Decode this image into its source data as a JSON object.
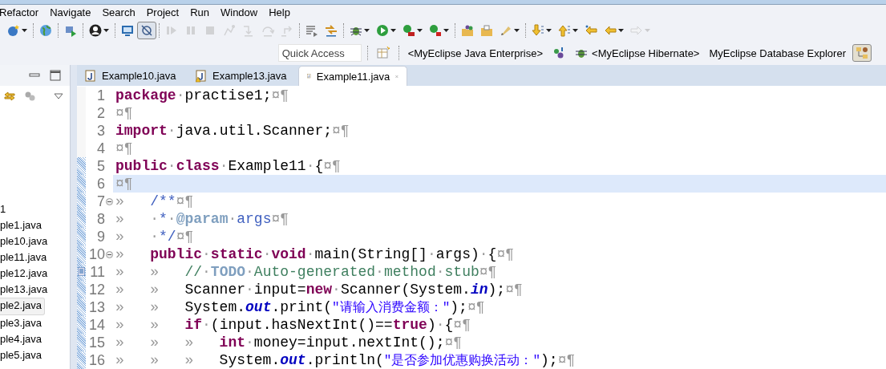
{
  "menu": [
    "Refactor",
    "Navigate",
    "Search",
    "Project",
    "Run",
    "Window",
    "Help"
  ],
  "toolbar": [
    {
      "kind": "new-wizard",
      "disabled": false,
      "dropdown": true
    },
    {
      "kind": "separator"
    },
    {
      "kind": "globe",
      "disabled": false,
      "dropdown": false
    },
    {
      "kind": "separator"
    },
    {
      "kind": "deploy",
      "disabled": false,
      "dropdown": false
    },
    {
      "kind": "separator"
    },
    {
      "kind": "person",
      "disabled": false,
      "dropdown": true
    },
    {
      "kind": "separator"
    },
    {
      "kind": "monitor",
      "disabled": false,
      "dropdown": false
    },
    {
      "kind": "skip",
      "disabled": false,
      "dropdown": false,
      "pressed": true
    },
    {
      "kind": "separator"
    },
    {
      "kind": "resume",
      "disabled": true,
      "dropdown": false
    },
    {
      "kind": "suspend",
      "disabled": true,
      "dropdown": false
    },
    {
      "kind": "terminate",
      "disabled": true,
      "dropdown": false
    },
    {
      "kind": "disconnect",
      "disabled": true,
      "dropdown": false
    },
    {
      "kind": "step-into",
      "disabled": true,
      "dropdown": false
    },
    {
      "kind": "step-over",
      "disabled": true,
      "dropdown": false
    },
    {
      "kind": "step-return",
      "disabled": true,
      "dropdown": false
    },
    {
      "kind": "separator"
    },
    {
      "kind": "lines",
      "disabled": false,
      "dropdown": false
    },
    {
      "kind": "filter",
      "disabled": false,
      "dropdown": false
    },
    {
      "kind": "separator"
    },
    {
      "kind": "bug",
      "disabled": false,
      "dropdown": true
    },
    {
      "kind": "run",
      "disabled": false,
      "dropdown": true
    },
    {
      "kind": "server-run",
      "disabled": false,
      "dropdown": true
    },
    {
      "kind": "server-stop",
      "disabled": false,
      "dropdown": true
    },
    {
      "kind": "separator"
    },
    {
      "kind": "folder-people",
      "disabled": false,
      "dropdown": false
    },
    {
      "kind": "folder",
      "disabled": false,
      "dropdown": false
    },
    {
      "kind": "pen",
      "disabled": false,
      "dropdown": true
    },
    {
      "kind": "separator"
    },
    {
      "kind": "next",
      "disabled": false,
      "dropdown": true
    },
    {
      "kind": "prev",
      "disabled": false,
      "dropdown": true
    },
    {
      "kind": "last-edit",
      "disabled": false,
      "dropdown": false
    },
    {
      "kind": "back",
      "disabled": false,
      "dropdown": true
    },
    {
      "kind": "forward",
      "disabled": true,
      "dropdown": true
    }
  ],
  "quick_access": {
    "placeholder": "Quick Access"
  },
  "perspectives": [
    {
      "kind": "label",
      "label": "<MyEclipse Java Enterprise>",
      "selected": false
    },
    {
      "kind": "team",
      "selected": false
    },
    {
      "kind": "bug",
      "label": "<MyEclipse Hibernate>",
      "selected": false
    },
    {
      "kind": "label",
      "label": "MyEclipse Database Explorer",
      "selected": false
    },
    {
      "kind": "database",
      "selected": true
    }
  ],
  "tree": [
    {
      "label": "1",
      "selected": false
    },
    {
      "label": "ple1.java",
      "selected": false
    },
    {
      "label": "ple10.java",
      "selected": false
    },
    {
      "label": "ple11.java",
      "selected": false
    },
    {
      "label": "ple12.java",
      "selected": false
    },
    {
      "label": "ple13.java",
      "selected": false
    },
    {
      "label": "ple2.java",
      "selected": true
    },
    {
      "label": "ple3.java",
      "selected": false
    },
    {
      "label": "ple4.java",
      "selected": false
    },
    {
      "label": "ple5.java",
      "selected": false
    }
  ],
  "editor_tabs": [
    {
      "label": "Example10.java",
      "selected": false,
      "warning": false
    },
    {
      "label": "Example13.java",
      "selected": false,
      "warning": true
    },
    {
      "label": "Example11.java",
      "selected": true,
      "warning": false
    }
  ],
  "lines": [
    {
      "number": "1",
      "fold": false,
      "task": false,
      "changed": false,
      "current": false,
      "tokens": [
        {
          "kind": "kw",
          "text": "package"
        },
        {
          "kind": "ws",
          "text": "·"
        },
        {
          "kind": "plain",
          "text": "practise1;"
        },
        {
          "kind": "ws",
          "text": "¤¶"
        }
      ]
    },
    {
      "number": "2",
      "fold": false,
      "task": false,
      "changed": false,
      "current": false,
      "tokens": [
        {
          "kind": "ws",
          "text": "¤¶"
        }
      ]
    },
    {
      "number": "3",
      "fold": false,
      "task": false,
      "changed": false,
      "current": false,
      "tokens": [
        {
          "kind": "kw",
          "text": "import"
        },
        {
          "kind": "ws",
          "text": "·"
        },
        {
          "kind": "plain",
          "text": "java.util.Scanner;"
        },
        {
          "kind": "ws",
          "text": "¤¶"
        }
      ]
    },
    {
      "number": "4",
      "fold": false,
      "task": false,
      "changed": false,
      "current": false,
      "tokens": [
        {
          "kind": "ws",
          "text": "¤¶"
        }
      ]
    },
    {
      "number": "5",
      "fold": false,
      "task": false,
      "changed": true,
      "current": false,
      "tokens": [
        {
          "kind": "kw",
          "text": "public"
        },
        {
          "kind": "ws",
          "text": "·"
        },
        {
          "kind": "kw",
          "text": "class"
        },
        {
          "kind": "ws",
          "text": "·"
        },
        {
          "kind": "plain",
          "text": "Example11"
        },
        {
          "kind": "ws",
          "text": "·"
        },
        {
          "kind": "plain",
          "text": "{"
        },
        {
          "kind": "ws",
          "text": "¤¶"
        }
      ]
    },
    {
      "number": "6",
      "fold": false,
      "task": false,
      "changed": true,
      "current": true,
      "tokens": [
        {
          "kind": "ws",
          "text": "¤¶"
        }
      ]
    },
    {
      "number": "7",
      "fold": true,
      "task": false,
      "changed": true,
      "current": false,
      "tokens": [
        {
          "kind": "tab",
          "text": "»"
        },
        {
          "kind": "doc",
          "text": "/**"
        },
        {
          "kind": "ws",
          "text": "¤¶"
        }
      ]
    },
    {
      "number": "8",
      "fold": false,
      "task": false,
      "changed": true,
      "current": false,
      "tokens": [
        {
          "kind": "tab",
          "text": "»"
        },
        {
          "kind": "ws",
          "text": "·"
        },
        {
          "kind": "doc",
          "text": "*"
        },
        {
          "kind": "ws",
          "text": "·"
        },
        {
          "kind": "tag",
          "text": "@param"
        },
        {
          "kind": "ws",
          "text": "·"
        },
        {
          "kind": "doc",
          "text": "args"
        },
        {
          "kind": "ws",
          "text": "¤¶"
        }
      ]
    },
    {
      "number": "9",
      "fold": false,
      "task": false,
      "changed": true,
      "current": false,
      "tokens": [
        {
          "kind": "tab",
          "text": "»"
        },
        {
          "kind": "ws",
          "text": "·"
        },
        {
          "kind": "doc",
          "text": "*/"
        },
        {
          "kind": "ws",
          "text": "¤¶"
        }
      ]
    },
    {
      "number": "10",
      "fold": true,
      "task": false,
      "changed": true,
      "current": false,
      "tokens": [
        {
          "kind": "tab",
          "text": "»"
        },
        {
          "kind": "kw",
          "text": "public"
        },
        {
          "kind": "ws",
          "text": "·"
        },
        {
          "kind": "kw",
          "text": "static"
        },
        {
          "kind": "ws",
          "text": "·"
        },
        {
          "kind": "kw",
          "text": "void"
        },
        {
          "kind": "ws",
          "text": "·"
        },
        {
          "kind": "plain",
          "text": "main(String[]"
        },
        {
          "kind": "ws",
          "text": "·"
        },
        {
          "kind": "plain",
          "text": "args)"
        },
        {
          "kind": "ws",
          "text": "·"
        },
        {
          "kind": "plain",
          "text": "{"
        },
        {
          "kind": "ws",
          "text": "¤¶"
        }
      ]
    },
    {
      "number": "11",
      "fold": false,
      "task": true,
      "changed": true,
      "current": false,
      "tokens": [
        {
          "kind": "tab",
          "text": "»"
        },
        {
          "kind": "tab",
          "text": "»"
        },
        {
          "kind": "comment",
          "text": "//"
        },
        {
          "kind": "ws",
          "text": "·"
        },
        {
          "kind": "todo",
          "text": "TODO"
        },
        {
          "kind": "ws",
          "text": "·"
        },
        {
          "kind": "comment",
          "text": "Auto-generated"
        },
        {
          "kind": "ws",
          "text": "·"
        },
        {
          "kind": "comment",
          "text": "method"
        },
        {
          "kind": "ws",
          "text": "·"
        },
        {
          "kind": "comment",
          "text": "stub"
        },
        {
          "kind": "ws",
          "text": "¤¶"
        }
      ]
    },
    {
      "number": "12",
      "fold": false,
      "task": false,
      "changed": true,
      "current": false,
      "tokens": [
        {
          "kind": "tab",
          "text": "»"
        },
        {
          "kind": "tab",
          "text": "»"
        },
        {
          "kind": "plain",
          "text": "Scanner"
        },
        {
          "kind": "ws",
          "text": "·"
        },
        {
          "kind": "plain",
          "text": "input="
        },
        {
          "kind": "kw",
          "text": "new"
        },
        {
          "kind": "ws",
          "text": "·"
        },
        {
          "kind": "plain",
          "text": "Scanner(System."
        },
        {
          "kind": "field",
          "text": "in"
        },
        {
          "kind": "plain",
          "text": ");"
        },
        {
          "kind": "ws",
          "text": "¤¶"
        }
      ]
    },
    {
      "number": "13",
      "fold": false,
      "task": false,
      "changed": true,
      "current": false,
      "tokens": [
        {
          "kind": "tab",
          "text": "»"
        },
        {
          "kind": "tab",
          "text": "»"
        },
        {
          "kind": "plain",
          "text": "System."
        },
        {
          "kind": "field",
          "text": "out"
        },
        {
          "kind": "plain",
          "text": ".print("
        },
        {
          "kind": "string",
          "text": "\"请输入消费金额：\""
        },
        {
          "kind": "plain",
          "text": ");"
        },
        {
          "kind": "ws",
          "text": "¤¶"
        }
      ]
    },
    {
      "number": "14",
      "fold": false,
      "task": false,
      "changed": true,
      "current": false,
      "tokens": [
        {
          "kind": "tab",
          "text": "»"
        },
        {
          "kind": "tab",
          "text": "»"
        },
        {
          "kind": "kw",
          "text": "if"
        },
        {
          "kind": "ws",
          "text": "·"
        },
        {
          "kind": "plain",
          "text": "(input.hasNextInt()=="
        },
        {
          "kind": "kw",
          "text": "true"
        },
        {
          "kind": "plain",
          "text": ")"
        },
        {
          "kind": "ws",
          "text": "·"
        },
        {
          "kind": "plain",
          "text": "{"
        },
        {
          "kind": "ws",
          "text": "¤¶"
        }
      ]
    },
    {
      "number": "15",
      "fold": false,
      "task": false,
      "changed": true,
      "current": false,
      "tokens": [
        {
          "kind": "tab",
          "text": "»"
        },
        {
          "kind": "tab",
          "text": "»"
        },
        {
          "kind": "tab",
          "text": "»"
        },
        {
          "kind": "kw",
          "text": "int"
        },
        {
          "kind": "ws",
          "text": "·"
        },
        {
          "kind": "plain",
          "text": "money=input.nextInt();"
        },
        {
          "kind": "ws",
          "text": "¤¶"
        }
      ]
    },
    {
      "number": "16",
      "fold": false,
      "task": false,
      "changed": true,
      "current": false,
      "tokens": [
        {
          "kind": "tab",
          "text": "»"
        },
        {
          "kind": "tab",
          "text": "»"
        },
        {
          "kind": "tab",
          "text": "»"
        },
        {
          "kind": "plain",
          "text": "System."
        },
        {
          "kind": "field",
          "text": "out"
        },
        {
          "kind": "plain",
          "text": ".println("
        },
        {
          "kind": "string",
          "text": "\"是否参加优惠购换活动：\""
        },
        {
          "kind": "plain",
          "text": ");"
        },
        {
          "kind": "ws",
          "text": "¤¶"
        }
      ]
    }
  ]
}
